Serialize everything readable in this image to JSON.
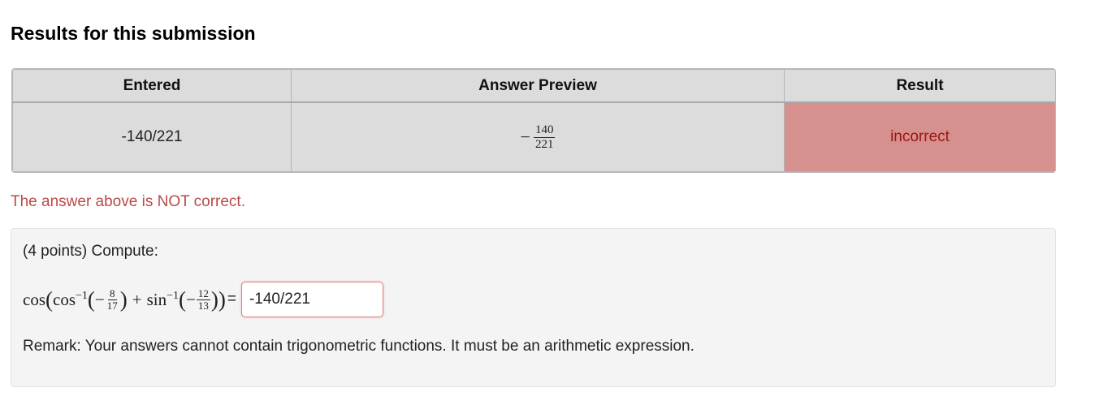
{
  "heading": "Results for this submission",
  "results_table": {
    "headers": [
      "Entered",
      "Answer Preview",
      "Result"
    ],
    "row": {
      "entered": "-140/221",
      "preview": {
        "sign": "−",
        "numerator": "140",
        "denominator": "221"
      },
      "result": "incorrect"
    },
    "colors": {
      "incorrect_bg": "#d6908e",
      "incorrect_text": "#9a1414"
    }
  },
  "status_message": "The answer above is NOT correct.",
  "problem": {
    "intro": "(4 points) Compute:",
    "math": {
      "cos": "cos",
      "arccos": "cos",
      "arcsin": "sin",
      "inv_exponent": "−1",
      "minus": "−",
      "plus": "+",
      "frac1": {
        "numerator": "8",
        "denominator": "17"
      },
      "frac2": {
        "numerator": "12",
        "denominator": "13"
      },
      "equals": "="
    },
    "answer_value": "-140/221",
    "remark": "Remark: Your answers cannot contain trigonometric functions. It must be an arithmetic expression."
  }
}
